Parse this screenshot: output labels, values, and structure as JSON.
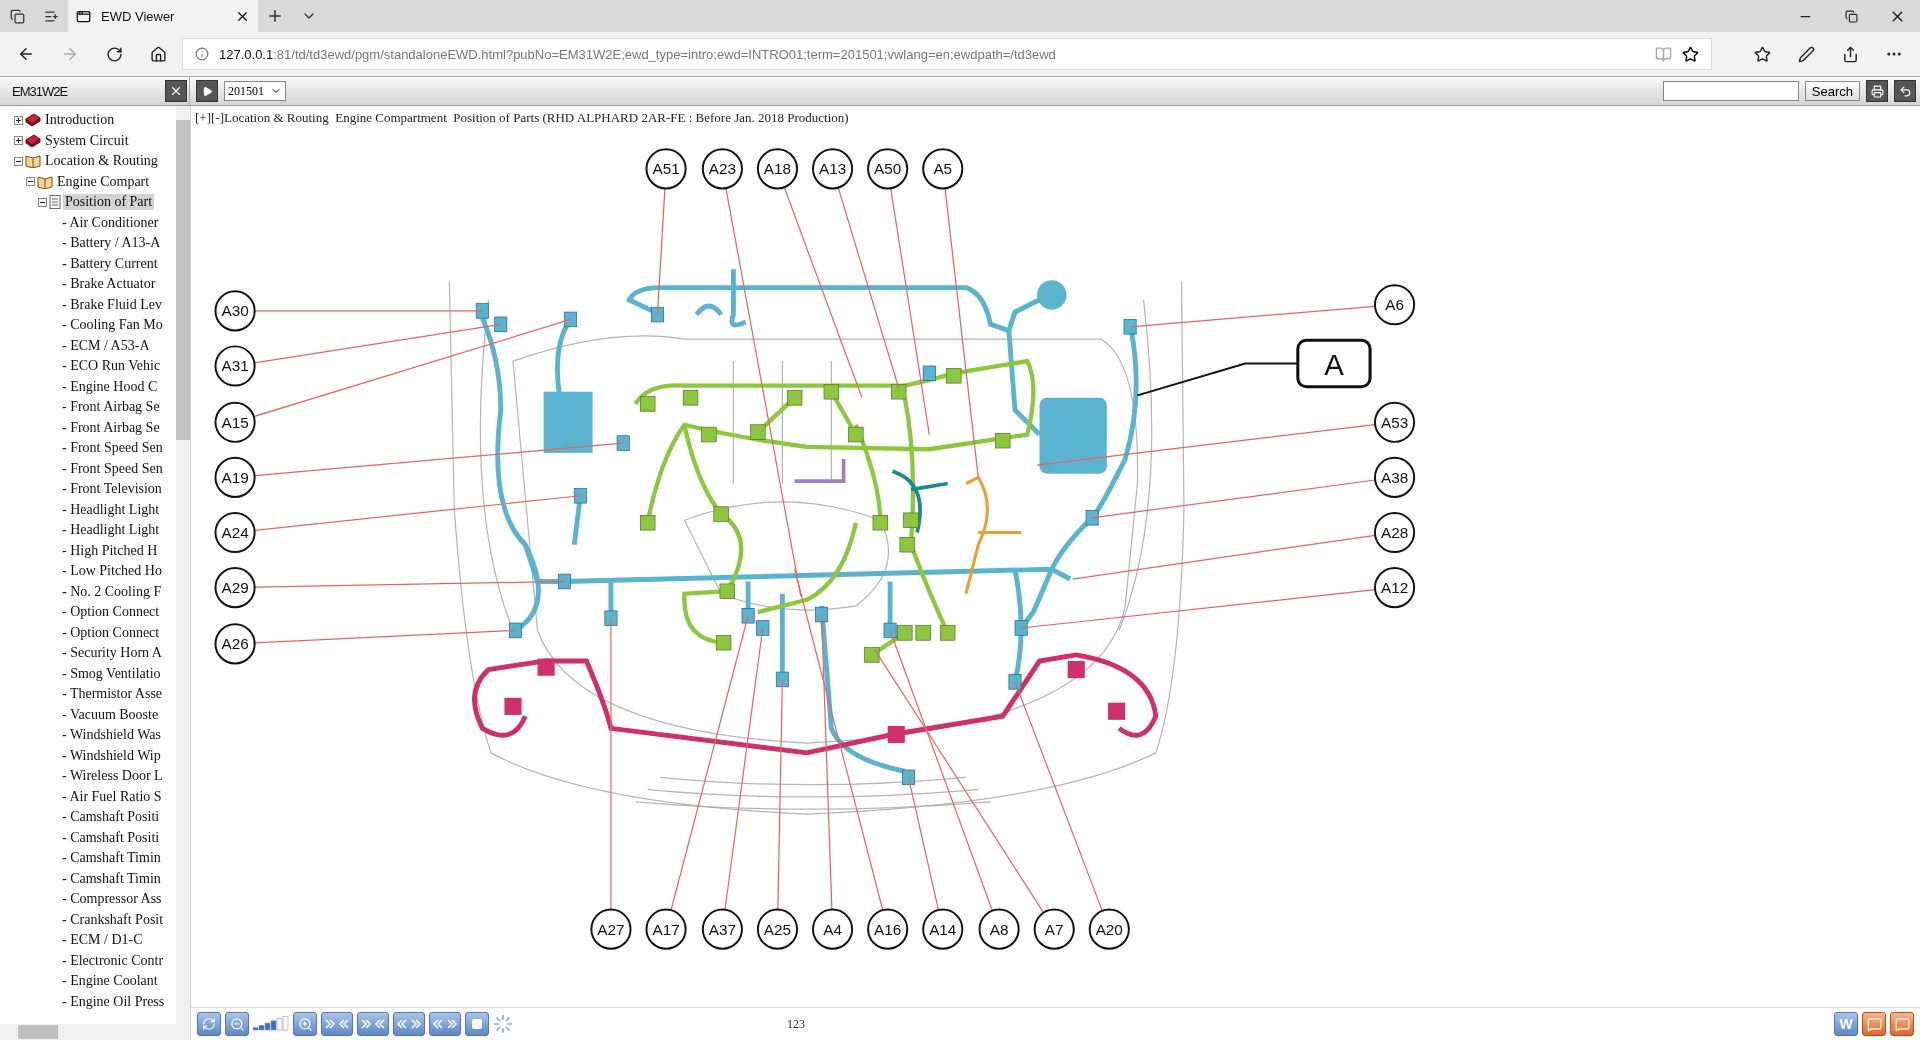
{
  "browser": {
    "tab_title": "EWD Viewer",
    "url_host": "127.0.0.1",
    "url_rest": ":81/td/td3ewd/pgm/standaloneEWD.html?pubNo=EM31W2E;ewd_type=intro;ewd=INTRO01;term=201501;vwlang=en;ewdpath=/td3ewd"
  },
  "app_toolbar": {
    "pub_no": "EM31W2E",
    "term": "201501",
    "search_button": "Search"
  },
  "tree": [
    {
      "label": "Introduction",
      "kind": "book",
      "expanded": false,
      "selected": false
    },
    {
      "label": "System Circuit",
      "kind": "book",
      "expanded": false,
      "selected": false
    },
    {
      "label": "Location & Routing",
      "kind": "book",
      "expanded": true,
      "selected": false,
      "children": [
        {
          "label": "Engine Compart",
          "kind": "book",
          "expanded": true,
          "selected": false,
          "children": [
            {
              "label": "Position of Part",
              "kind": "page",
              "expanded": true,
              "selected": true,
              "children": [
                {
                  "label": "- Air Conditioner",
                  "kind": "leaf",
                  "selected": false
                },
                {
                  "label": "- Battery / A13-A",
                  "kind": "leaf",
                  "selected": false
                },
                {
                  "label": "- Battery Current",
                  "kind": "leaf",
                  "selected": false
                },
                {
                  "label": "- Brake Actuator",
                  "kind": "leaf",
                  "selected": false
                },
                {
                  "label": "- Brake Fluid Lev",
                  "kind": "leaf",
                  "selected": false
                },
                {
                  "label": "- Cooling Fan Mo",
                  "kind": "leaf",
                  "selected": false
                },
                {
                  "label": "- ECM / A53-A",
                  "kind": "leaf",
                  "selected": false
                },
                {
                  "label": "- ECO Run Vehic",
                  "kind": "leaf",
                  "selected": false
                },
                {
                  "label": "- Engine Hood C",
                  "kind": "leaf",
                  "selected": false
                },
                {
                  "label": "- Front Airbag Se",
                  "kind": "leaf",
                  "selected": false
                },
                {
                  "label": "- Front Airbag Se",
                  "kind": "leaf",
                  "selected": false
                },
                {
                  "label": "- Front Speed Sen",
                  "kind": "leaf",
                  "selected": false
                },
                {
                  "label": "- Front Speed Sen",
                  "kind": "leaf",
                  "selected": false
                },
                {
                  "label": "- Front Television",
                  "kind": "leaf",
                  "selected": false
                },
                {
                  "label": "- Headlight Light",
                  "kind": "leaf",
                  "selected": false
                },
                {
                  "label": "- Headlight Light",
                  "kind": "leaf",
                  "selected": false
                },
                {
                  "label": "- High Pitched H",
                  "kind": "leaf",
                  "selected": false
                },
                {
                  "label": "- Low Pitched Ho",
                  "kind": "leaf",
                  "selected": false
                },
                {
                  "label": "- No. 2 Cooling F",
                  "kind": "leaf",
                  "selected": false
                },
                {
                  "label": "- Option Connect",
                  "kind": "leaf",
                  "selected": false
                },
                {
                  "label": "- Option Connect",
                  "kind": "leaf",
                  "selected": false
                },
                {
                  "label": "- Security Horn A",
                  "kind": "leaf",
                  "selected": false
                },
                {
                  "label": "- Smog Ventilatio",
                  "kind": "leaf",
                  "selected": false
                },
                {
                  "label": "- Thermistor Asse",
                  "kind": "leaf",
                  "selected": false
                },
                {
                  "label": "- Vacuum Booste",
                  "kind": "leaf",
                  "selected": false
                },
                {
                  "label": "- Windshield Was",
                  "kind": "leaf",
                  "selected": false
                },
                {
                  "label": "- Windshield Wip",
                  "kind": "leaf",
                  "selected": false
                },
                {
                  "label": "- Wireless Door L",
                  "kind": "leaf",
                  "selected": false
                },
                {
                  "label": "- Air Fuel Ratio S",
                  "kind": "leaf",
                  "selected": false
                },
                {
                  "label": "- Camshaft Positi",
                  "kind": "leaf",
                  "selected": false
                },
                {
                  "label": "- Camshaft Positi",
                  "kind": "leaf",
                  "selected": false
                },
                {
                  "label": "- Camshaft Timin",
                  "kind": "leaf",
                  "selected": false
                },
                {
                  "label": "- Camshaft Timin",
                  "kind": "leaf",
                  "selected": false
                },
                {
                  "label": "- Compressor Ass",
                  "kind": "leaf",
                  "selected": false
                },
                {
                  "label": "- Crankshaft Posit",
                  "kind": "leaf",
                  "selected": false
                },
                {
                  "label": "- ECM / D1-C",
                  "kind": "leaf",
                  "selected": false
                },
                {
                  "label": "- Electronic Contr",
                  "kind": "leaf",
                  "selected": false
                },
                {
                  "label": "- Engine Coolant",
                  "kind": "leaf",
                  "selected": false
                },
                {
                  "label": "- Engine Oil Press",
                  "kind": "leaf",
                  "selected": false
                }
              ]
            }
          ]
        }
      ]
    }
  ],
  "breadcrumb": "[+][-]Location & Routing  Engine Compartment  Position of Parts (RHD ALPHARD 2AR-FE : Before Jan. 2018 Production)",
  "diagram": {
    "view_label": "A",
    "callouts_top": [
      "A51",
      "A23",
      "A18",
      "A13",
      "A50",
      "A5"
    ],
    "callouts_left": [
      "A30",
      "A31",
      "A15",
      "A19",
      "A24",
      "A29",
      "A26"
    ],
    "callouts_right": [
      "A6",
      "A53",
      "A38",
      "A28",
      "A12"
    ],
    "callouts_bottom": [
      "A27",
      "A17",
      "A37",
      "A25",
      "A4",
      "A16",
      "A14",
      "A8",
      "A7",
      "A20"
    ]
  },
  "footer": {
    "page": "123",
    "word_button": "W"
  }
}
